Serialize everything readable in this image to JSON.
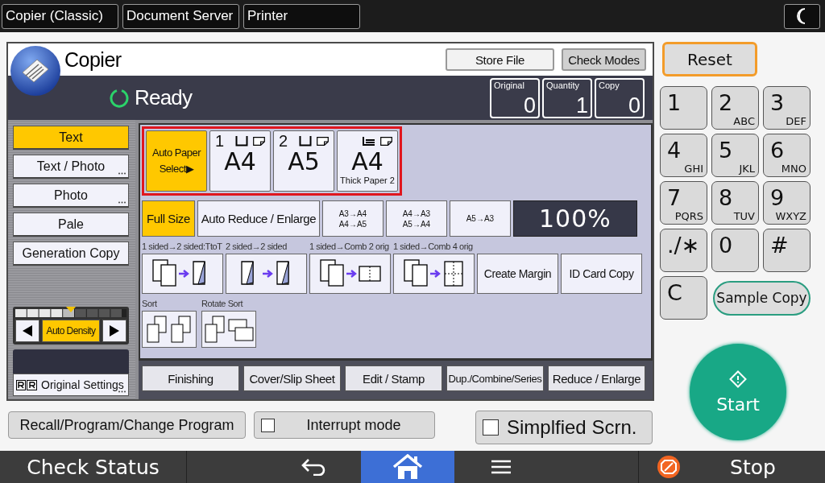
{
  "top_tabs": [
    {
      "label": "Copier (Classic)"
    },
    {
      "label": "Document Server"
    },
    {
      "label": "Printer"
    }
  ],
  "app": {
    "title": "Copier",
    "buttons": [
      "Store File",
      "Check Modes"
    ],
    "status": "Ready",
    "counters": [
      {
        "label": "Original",
        "value": "0"
      },
      {
        "label": "Quantity",
        "value": "1"
      },
      {
        "label": "Copy",
        "value": "0"
      }
    ]
  },
  "original_types": [
    {
      "label": "Text",
      "selected": true,
      "has_options": false
    },
    {
      "label": "Text / Photo",
      "selected": false,
      "has_options": true
    },
    {
      "label": "Photo",
      "selected": false,
      "has_options": true
    },
    {
      "label": "Pale",
      "selected": false,
      "has_options": false
    },
    {
      "label": "Generation Copy",
      "selected": false,
      "has_options": false
    }
  ],
  "density": {
    "label": "Auto Density",
    "selected": true,
    "level": 0.5
  },
  "original_settings": {
    "label": "Original Settings"
  },
  "paper": [
    {
      "kind": "auto",
      "lines": [
        "Auto Paper",
        "Select▶"
      ],
      "selected": true
    },
    {
      "kind": "tray",
      "tray": "1",
      "size": "A4",
      "selected": false
    },
    {
      "kind": "tray",
      "tray": "2",
      "size": "A5",
      "selected": false
    },
    {
      "kind": "bypass",
      "size": "A4",
      "note": "Thick Paper 2",
      "selected": false
    }
  ],
  "ratios": [
    {
      "lines": [
        "Full Size"
      ],
      "selected": true,
      "kind": "text"
    },
    {
      "lines": [
        "Auto Reduce / Enlarge"
      ],
      "selected": false,
      "kind": "text"
    },
    {
      "lines": [
        "A3→A4",
        "A4→A5"
      ],
      "selected": false,
      "kind": "preset"
    },
    {
      "lines": [
        "A4→A3",
        "A5→A4"
      ],
      "selected": false,
      "kind": "preset"
    },
    {
      "lines": [
        "A5→A3"
      ],
      "selected": false,
      "kind": "preset"
    }
  ],
  "ratio_display": "100%",
  "duplex": [
    {
      "kind": "one-to-two",
      "caption": "1 sided→2 sided:TtoT"
    },
    {
      "kind": "two-to-two",
      "caption": "2 sided→2 sided"
    },
    {
      "kind": "comb2",
      "caption": "1 sided→Comb 2 orig"
    },
    {
      "kind": "comb4",
      "caption": "1 sided→Comb 4 orig"
    },
    {
      "kind": "text",
      "label": "Create Margin"
    },
    {
      "kind": "text",
      "label": "ID Card Copy"
    }
  ],
  "sort": [
    {
      "kind": "sort",
      "caption": "Sort"
    },
    {
      "kind": "rotate",
      "caption": "Rotate Sort"
    }
  ],
  "function_tabs": [
    "Finishing",
    "Cover/Slip Sheet",
    "Edit / Stamp",
    "Dup./Combine/Series",
    "Reduce / Enlarge"
  ],
  "recall": "Recall/Program/Change Program",
  "interrupt": {
    "label": "Interrupt mode",
    "checked": false
  },
  "simplified": {
    "label": "Simplfied Scrn.",
    "checked": false
  },
  "keypad": {
    "reset": "Reset",
    "keys": [
      {
        "digit": "1"
      },
      {
        "digit": "2",
        "letters": "ABC"
      },
      {
        "digit": "3",
        "letters": "DEF"
      },
      {
        "digit": "4",
        "letters": "GHI"
      },
      {
        "digit": "5",
        "letters": "JKL"
      },
      {
        "digit": "6",
        "letters": "MNO"
      },
      {
        "digit": "7",
        "letters": "PQRS"
      },
      {
        "digit": "8",
        "letters": "TUV"
      },
      {
        "digit": "9",
        "letters": "WXYZ"
      },
      {
        "digit": "./∗"
      },
      {
        "digit": "0"
      },
      {
        "digit": "#"
      },
      {
        "digit": "C"
      }
    ],
    "sample_copy": "Sample Copy",
    "start": "Start"
  },
  "nav": {
    "check_status": "Check Status",
    "items": [
      {
        "kind": "back",
        "selected": false
      },
      {
        "kind": "home",
        "selected": true
      },
      {
        "kind": "menu",
        "selected": false
      }
    ],
    "stop": "Stop"
  }
}
